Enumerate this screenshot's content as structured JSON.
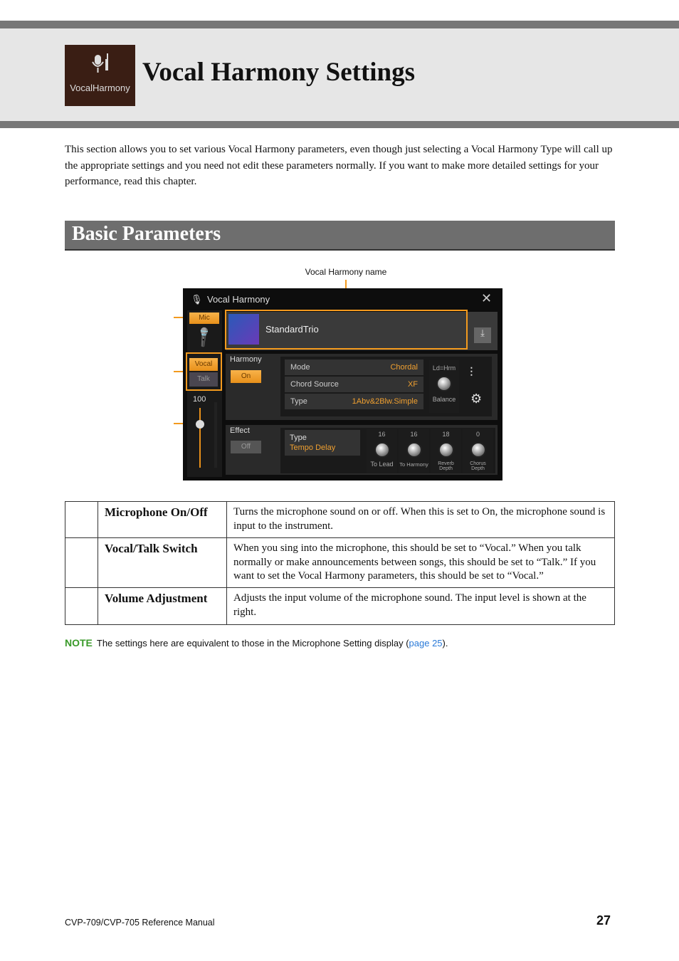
{
  "header": {
    "logo_label": "VocalHarmony",
    "title": "Vocal Harmony Settings"
  },
  "intro": "This section allows you to set various Vocal Harmony parameters, even though just selecting a Vocal Harmony Type will call up the appropriate settings and you need not edit these parameters normally. If you want to make more detailed settings for your performance, read this chapter.",
  "section_title": "Basic Parameters",
  "callout": "Vocal Harmony name",
  "screen": {
    "title": "Vocal Harmony",
    "mic": "Mic",
    "vocal": "Vocal",
    "talk": "Talk",
    "volume": "100",
    "name": "StandardTrio",
    "harmony_label": "Harmony",
    "harmony_state": "On",
    "rows": [
      {
        "label": "Mode",
        "value": "Chordal"
      },
      {
        "label": "Chord Source",
        "value": "XF"
      },
      {
        "label": "Type",
        "value": "1Abv&2Blw.Simple"
      }
    ],
    "balance_top": "Ld=Hrm",
    "balance_label": "Balance",
    "effect_label": "Effect",
    "effect_state": "Off",
    "effect_type_label": "Type",
    "effect_type": "Tempo Delay",
    "knobs": [
      {
        "value": "16",
        "label": "To Lead"
      },
      {
        "value": "16",
        "label": "To Harmony"
      },
      {
        "value": "18",
        "label": "Reverb Depth"
      },
      {
        "value": "0",
        "label": "Chorus Depth"
      }
    ],
    "accent": "#f39a1e"
  },
  "table": [
    {
      "name": "Microphone On/Off",
      "desc": "Turns the microphone sound on or off. When this is set to On, the microphone sound is input to the instrument."
    },
    {
      "name": "Vocal/Talk Switch",
      "desc": "When you sing into the microphone, this should be set to “Vocal.” When you talk normally or make announcements between songs, this should be set to “Talk.” If you want to set the Vocal Harmony parameters, this should be set to “Vocal.”"
    },
    {
      "name": "Volume Adjustment",
      "desc": "Adjusts the input volume of the microphone sound. The input level is shown at the right."
    }
  ],
  "note": {
    "label": "NOTE",
    "text": "The settings here are equivalent to those in the Microphone Setting display (",
    "link": "page 25",
    "end": ")."
  },
  "footer": {
    "manual": "CVP-709/CVP-705 Reference Manual",
    "page": "27"
  }
}
